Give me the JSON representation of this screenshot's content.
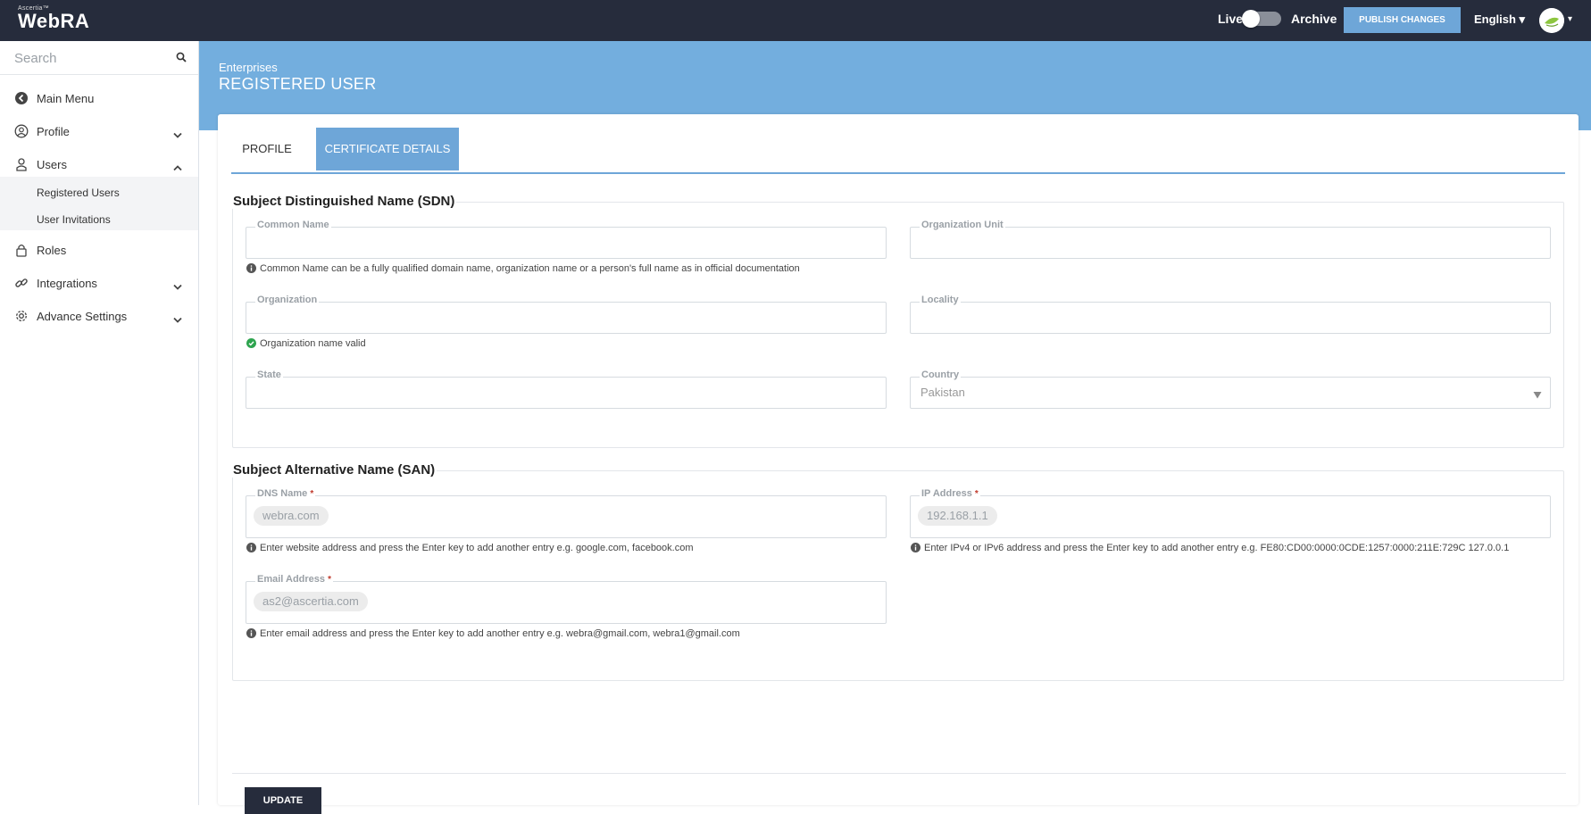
{
  "topbar": {
    "brand_small": "Ascertia™",
    "brand": "WebRA",
    "live_label": "Live",
    "archive_label": "Archive",
    "publish_label": "PUBLISH CHANGES",
    "language": "English ▾",
    "avatar_caret": "▾"
  },
  "sidebar": {
    "search_placeholder": "Search",
    "items": [
      {
        "label": "Main Menu",
        "icon": "back-circle-icon"
      },
      {
        "label": "Profile",
        "icon": "user-circle-icon"
      },
      {
        "label": "Users",
        "icon": "users-icon"
      },
      {
        "label": "Roles",
        "icon": "lock-icon"
      },
      {
        "label": "Integrations",
        "icon": "link-icon"
      },
      {
        "label": "Advance Settings",
        "icon": "gear-icon"
      }
    ],
    "subitems": [
      "Registered Users",
      "User Invitations"
    ]
  },
  "header": {
    "breadcrumb": "Enterprises",
    "title": "REGISTERED USER"
  },
  "tabs": [
    "PROFILE",
    "CERTIFICATE DETAILS"
  ],
  "sdn": {
    "title": "Subject Distinguished Name (SDN)",
    "common_name_label": "Common Name",
    "common_name_hint": "Common Name can be a fully qualified domain name, organization name or a person's full name as in official documentation",
    "org_unit_label": "Organization Unit",
    "organization_label": "Organization",
    "organization_status": "Organization name valid",
    "locality_label": "Locality",
    "state_label": "State",
    "country_label": "Country",
    "country_value": "Pakistan"
  },
  "san": {
    "title": "Subject Alternative Name (SAN)",
    "dns_label": "DNS Name",
    "dns_value": "webra.com",
    "dns_hint": "Enter website address and press the Enter key to add another entry e.g. google.com, facebook.com",
    "ip_label": "IP Address",
    "ip_value": "192.168.1.1",
    "ip_hint": "Enter IPv4 or IPv6 address and press the Enter key to add another entry e.g. FE80:CD00:0000:0CDE:1257:0000:211E:729C 127.0.0.1",
    "email_label": "Email Address",
    "email_value": "as2@ascertia.com",
    "email_hint": "Enter email address and press the Enter key to add another entry e.g. webra@gmail.com, webra1@gmail.com",
    "required_mark": "*"
  },
  "actions": {
    "update_label": "UPDATE"
  },
  "colors": {
    "topbar": "#262c3c",
    "accent": "#6ea6d8",
    "header": "#73aede",
    "valid": "#2ea44f"
  }
}
